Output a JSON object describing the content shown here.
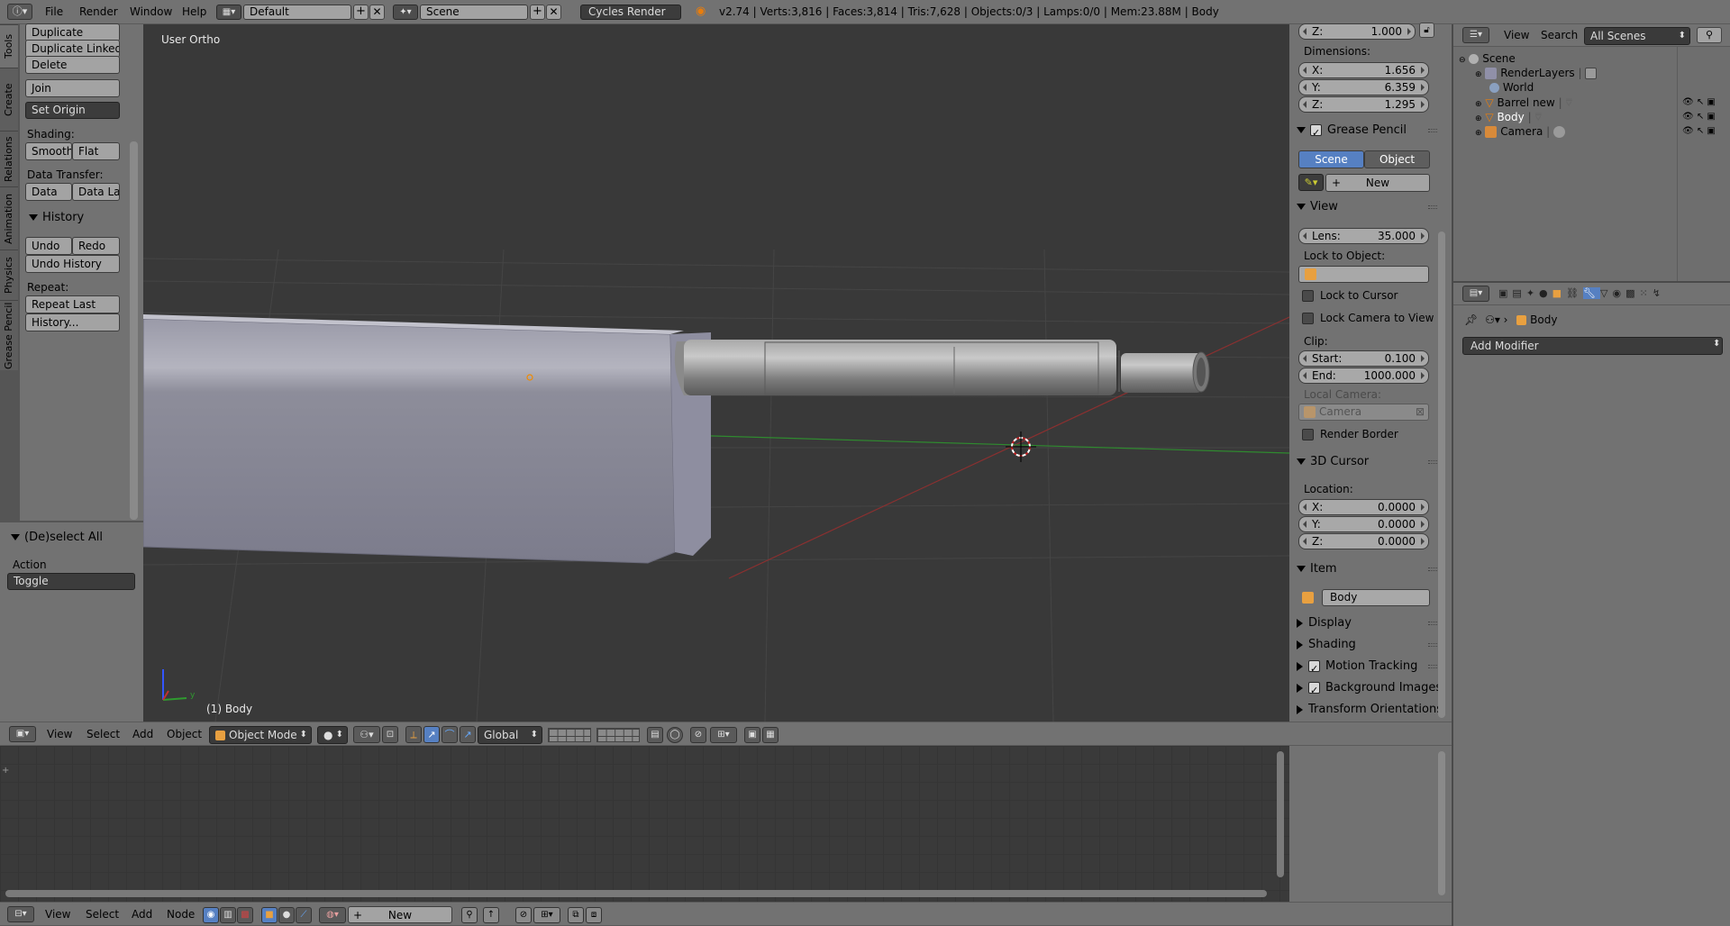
{
  "topbar": {
    "menus": [
      "File",
      "Render",
      "Window",
      "Help"
    ],
    "layout": "Default",
    "scene": "Scene",
    "engine": "Cycles Render",
    "stats": "v2.74 | Verts:3,816 | Faces:3,814 | Tris:7,628 | Objects:0/3 | Lamps:0/0 | Mem:23.88M | Body"
  },
  "toolshelf": {
    "tabs": [
      "Tools",
      "Create",
      "Relations",
      "Animation",
      "Physics",
      "Grease Pencil"
    ],
    "buttons": {
      "duplicate": "Duplicate",
      "duplicate_linked": "Duplicate Linked",
      "delete": "Delete",
      "join": "Join",
      "set_origin": "Set Origin"
    },
    "shading_label": "Shading:",
    "smooth": "Smooth",
    "flat": "Flat",
    "data_transfer_label": "Data Transfer:",
    "data": "Data",
    "data_la": "Data La",
    "history_title": "History",
    "undo": "Undo",
    "redo": "Redo",
    "undo_history": "Undo History",
    "repeat_label": "Repeat:",
    "repeat_last": "Repeat Last",
    "history_more": "History...",
    "operator_title": "(De)select All",
    "action_label": "Action",
    "action_value": "Toggle"
  },
  "viewport": {
    "view_name": "User Ortho",
    "object_label": "(1) Body",
    "axis_y": "y"
  },
  "viewport_header": {
    "menus": [
      "View",
      "Select",
      "Add",
      "Object"
    ],
    "mode": "Object Mode",
    "orientation": "Global"
  },
  "props": {
    "z_top": {
      "k": "Z:",
      "v": "1.000"
    },
    "dimensions_label": "Dimensions:",
    "dims": [
      {
        "k": "X:",
        "v": "1.656"
      },
      {
        "k": "Y:",
        "v": "6.359"
      },
      {
        "k": "Z:",
        "v": "1.295"
      }
    ],
    "grease_pencil": "Grease Pencil",
    "scene_btn": "Scene",
    "object_btn": "Object",
    "new_btn": "New",
    "view_title": "View",
    "lens": {
      "k": "Lens:",
      "v": "35.000"
    },
    "lock_to_object": "Lock to Object:",
    "lock_to_cursor": "Lock to Cursor",
    "lock_camera": "Lock Camera to View",
    "clip_label": "Clip:",
    "clip_start": {
      "k": "Start:",
      "v": "0.100"
    },
    "clip_end": {
      "k": "End:",
      "v": "1000.000"
    },
    "local_camera": "Local Camera:",
    "camera": "Camera",
    "render_border": "Render Border",
    "cursor_title": "3D Cursor",
    "location_label": "Location:",
    "loc": [
      {
        "k": "X:",
        "v": "0.0000"
      },
      {
        "k": "Y:",
        "v": "0.0000"
      },
      {
        "k": "Z:",
        "v": "0.0000"
      }
    ],
    "item_title": "Item",
    "item_name": "Body",
    "display": "Display",
    "shading": "Shading",
    "motion_tracking": "Motion Tracking",
    "background_images": "Background Images",
    "transform_orientations": "Transform Orientations"
  },
  "outliner": {
    "menus": [
      "View",
      "Search"
    ],
    "filter": "All Scenes",
    "items": [
      "Scene",
      "RenderLayers",
      "World",
      "Barrel new",
      "Body",
      "Camera"
    ]
  },
  "properties_editor": {
    "breadcrumb": "Body",
    "add_modifier": "Add Modifier"
  },
  "node_header": {
    "menus": [
      "View",
      "Select",
      "Add",
      "Node"
    ],
    "new_btn": "New"
  }
}
